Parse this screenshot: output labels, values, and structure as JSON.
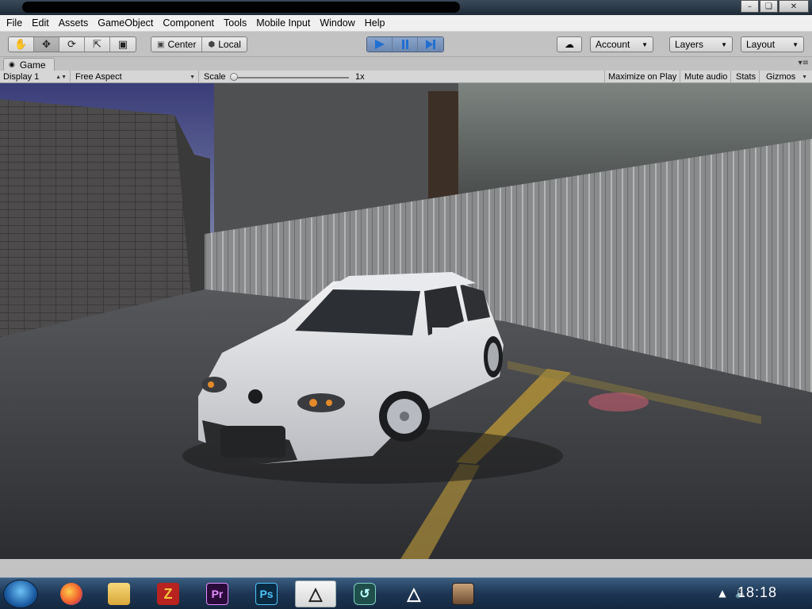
{
  "window": {
    "title_obscured": ""
  },
  "menu": [
    "File",
    "Edit",
    "Assets",
    "GameObject",
    "Component",
    "Tools",
    "Mobile Input",
    "Window",
    "Help"
  ],
  "toolbar": {
    "tools": [
      "hand-tool-icon",
      "move-tool-icon",
      "rotate-tool-icon",
      "scale-tool-icon",
      "rect-tool-icon"
    ],
    "active_tool": "move-tool-icon",
    "pivot_mode": "Center",
    "pivot_space": "Local",
    "play_controls": [
      "play-icon",
      "pause-icon",
      "step-icon"
    ],
    "play_active": true,
    "account": "Account",
    "layers": "Layers",
    "layout": "Layout"
  },
  "game_tab": {
    "label": "Game"
  },
  "game_bar": {
    "display": "Display 1",
    "aspect": "Free Aspect",
    "scale_label": "Scale",
    "scale_value": "1x",
    "maximize": "Maximize on Play",
    "mute": "Mute audio",
    "stats": "Stats",
    "gizmos": "Gizmos"
  },
  "taskbar": {
    "apps": [
      "firefox-icon",
      "file-explorer-icon",
      "filezilla-icon",
      "premiere-icon",
      "photoshop-icon",
      "unity-icon",
      "gamemaker-icon",
      "unity-icon",
      "gta-icon"
    ],
    "premiere_label": "Pr",
    "photoshop_label": "Ps",
    "filezilla_label": "Z",
    "clock": "18:18"
  },
  "colors": {
    "play_accent": "#6c88b1",
    "toolbar_bg": "#c2c2c2",
    "taskbar_bg": "#1d3654"
  }
}
